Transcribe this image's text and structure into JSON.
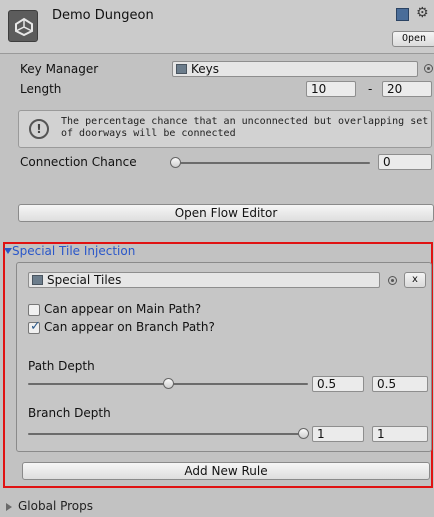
{
  "header": {
    "title": "Demo Dungeon",
    "open_label": "Open"
  },
  "key_manager": {
    "label": "Key Manager",
    "value": "Keys"
  },
  "length": {
    "label": "Length",
    "min": "10",
    "separator": "-",
    "max": "20"
  },
  "help": {
    "text": "The percentage chance that an unconnected but overlapping set of doorways will be connected"
  },
  "connection_chance": {
    "label": "Connection Chance",
    "value": "0"
  },
  "open_flow_editor": {
    "label": "Open Flow Editor"
  },
  "special_tile_injection": {
    "title": "Special Tile Injection",
    "rule": {
      "tileset": "Special Tiles",
      "remove_label": "x",
      "main_path": {
        "label": "Can appear on Main Path?",
        "checked": false
      },
      "branch_path": {
        "label": "Can appear on Branch Path?",
        "checked": true
      },
      "path_depth": {
        "label": "Path Depth",
        "min": "0.5",
        "max": "0.5"
      },
      "branch_depth": {
        "label": "Branch Depth",
        "min": "1",
        "max": "1"
      }
    },
    "add_rule_label": "Add New Rule"
  },
  "global_props": {
    "title": "Global Props"
  }
}
